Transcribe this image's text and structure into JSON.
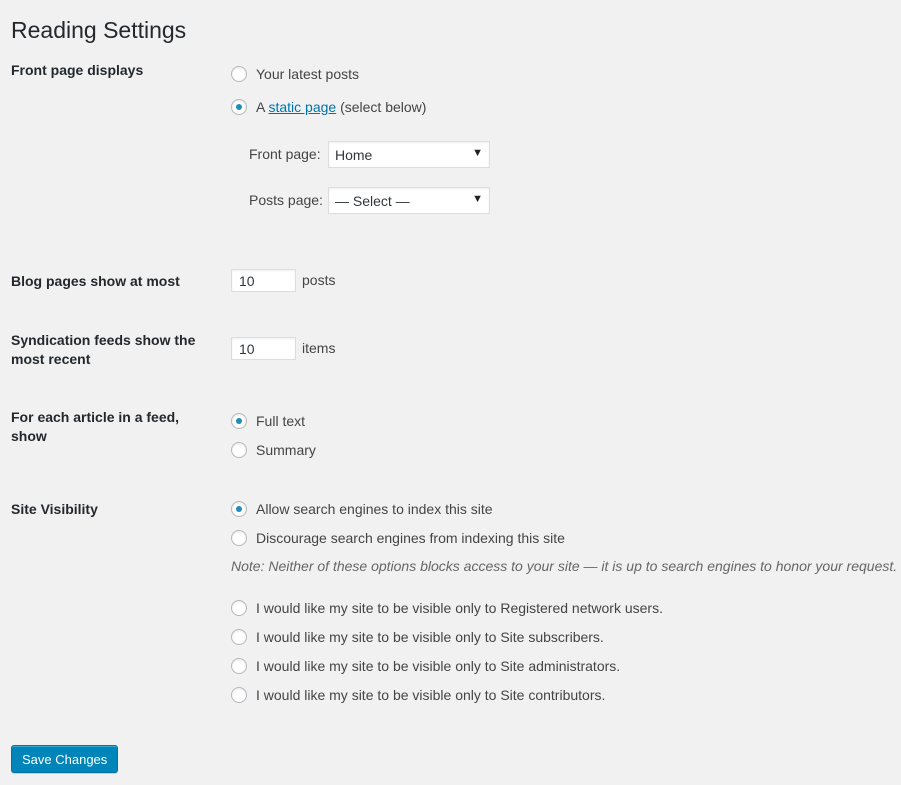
{
  "page": {
    "title": "Reading Settings"
  },
  "front_page": {
    "label": "Front page displays",
    "options": [
      {
        "text": "Your latest posts",
        "checked": false
      },
      {
        "prefix": "A ",
        "link": "static page",
        "suffix": " (select below)",
        "checked": true
      }
    ],
    "front_page_label": "Front page:",
    "front_page_value": "Home",
    "posts_page_label": "Posts page:",
    "posts_page_value": "— Select —"
  },
  "blog_pages": {
    "label": "Blog pages show at most",
    "value": "10",
    "unit": "posts"
  },
  "syndication": {
    "label": "Syndication feeds show the most recent",
    "value": "10",
    "unit": "items"
  },
  "feed_article": {
    "label": "For each article in a feed, show",
    "options": [
      {
        "text": "Full text",
        "checked": true
      },
      {
        "text": "Summary",
        "checked": false
      }
    ]
  },
  "visibility": {
    "label": "Site Visibility",
    "options": [
      {
        "text": "Allow search engines to index this site",
        "checked": true
      },
      {
        "text": "Discourage search engines from indexing this site",
        "checked": false
      }
    ],
    "note": "Note: Neither of these options blocks access to your site — it is up to search engines to honor your request.",
    "restricted_options": [
      {
        "text": "I would like my site to be visible only to Registered network users.",
        "checked": false
      },
      {
        "text": "I would like my site to be visible only to Site subscribers.",
        "checked": false
      },
      {
        "text": "I would like my site to be visible only to Site administrators.",
        "checked": false
      },
      {
        "text": "I would like my site to be visible only to Site contributors.",
        "checked": false
      }
    ]
  },
  "save_button": {
    "label": "Save Changes"
  },
  "colors": {
    "accent": "#0085ba",
    "link": "#0073aa",
    "background": "#f1f1f1"
  }
}
